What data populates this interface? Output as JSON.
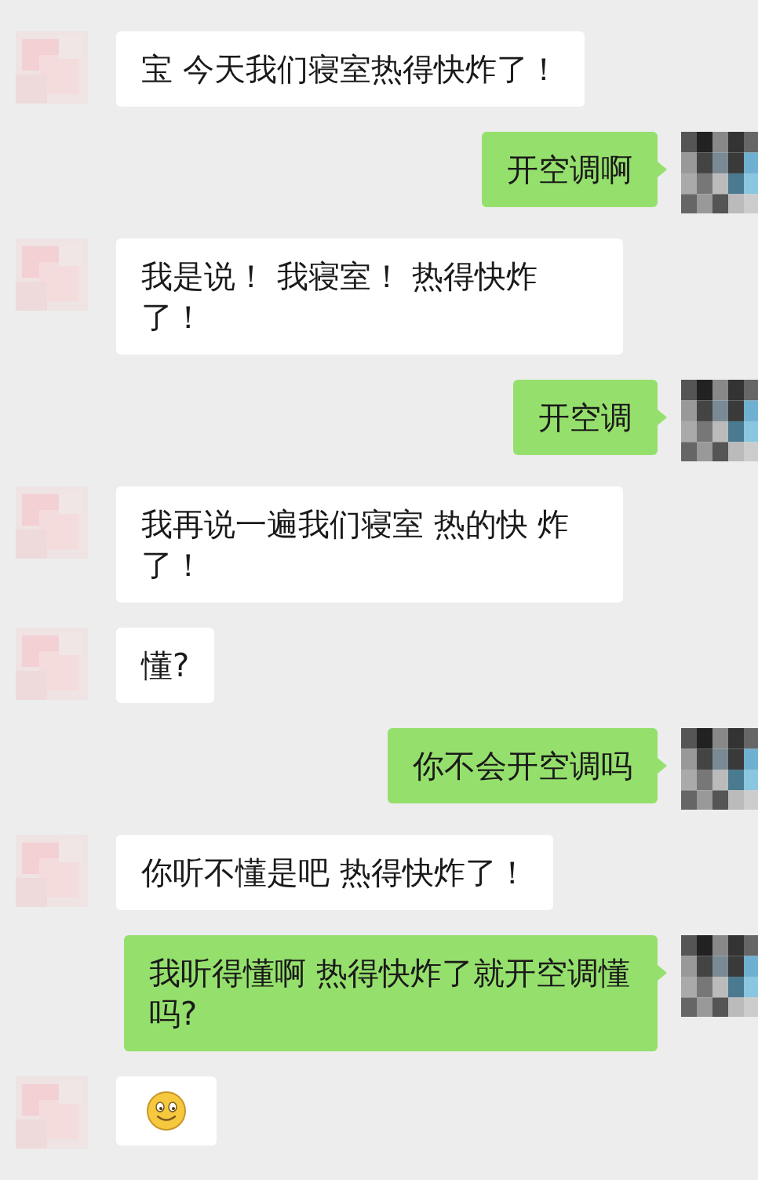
{
  "messages": [
    {
      "kind": "received",
      "text": "宝 今天我们寝室热得快炸了！"
    },
    {
      "kind": "sent",
      "text": "开空调啊"
    },
    {
      "kind": "received",
      "text": "我是说！ 我寝室！ 热得快炸了！"
    },
    {
      "kind": "sent",
      "text": "开空调"
    },
    {
      "kind": "received",
      "text": "我再说一遍我们寝室 热的快 炸了！"
    },
    {
      "kind": "received",
      "text": "懂?"
    },
    {
      "kind": "sent",
      "text": "你不会开空调吗"
    },
    {
      "kind": "received",
      "text": "你听不懂是吧 热得快炸了！"
    },
    {
      "kind": "sent",
      "text": "我听得懂啊 热得快炸了就开空调懂吗?"
    },
    {
      "kind": "emoji"
    }
  ]
}
